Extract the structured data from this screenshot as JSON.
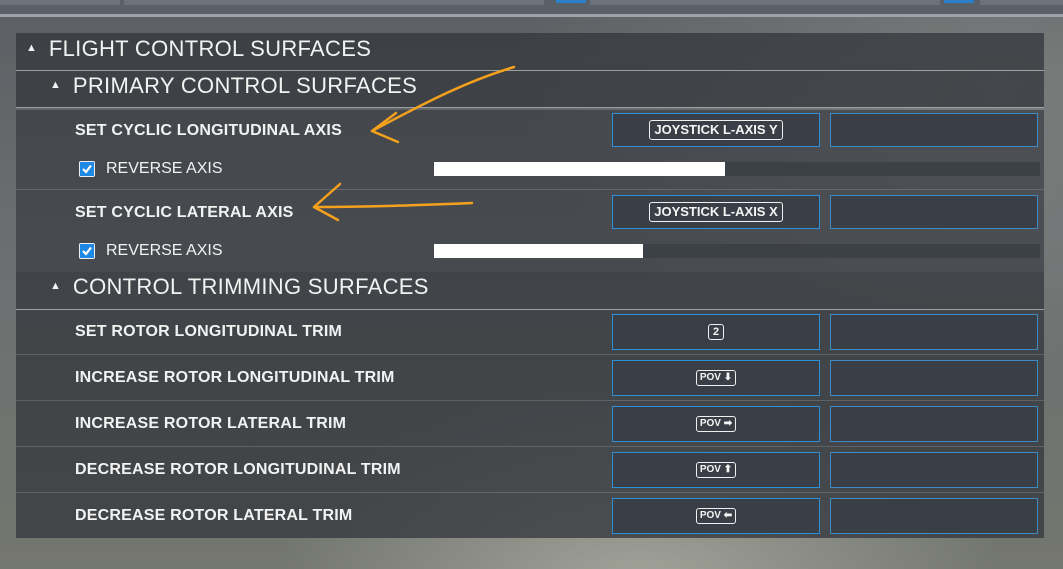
{
  "sections": {
    "flight_control": "FLIGHT CONTROL SURFACES",
    "primary": "PRIMARY CONTROL SURFACES",
    "trimming": "CONTROL TRIMMING SURFACES"
  },
  "primary_rows": [
    {
      "label": "SET CYCLIC LONGITUDINAL AXIS",
      "binding": "JOYSTICK L-AXIS Y",
      "reverse_label": "REVERSE AXIS",
      "reverse_checked": true,
      "axis_position": 0.48
    },
    {
      "label": "SET CYCLIC LATERAL AXIS",
      "binding": "JOYSTICK L-AXIS X",
      "reverse_label": "REVERSE AXIS",
      "reverse_checked": true,
      "axis_position": 0.345
    }
  ],
  "trim_rows": [
    {
      "label": "SET ROTOR LONGITUDINAL TRIM",
      "binding": "2"
    },
    {
      "label": "INCREASE ROTOR LONGITUDINAL TRIM",
      "binding": "POV ⬇"
    },
    {
      "label": "INCREASE ROTOR LATERAL TRIM",
      "binding": "POV ➡"
    },
    {
      "label": "DECREASE ROTOR LONGITUDINAL TRIM",
      "binding": "POV ⬆"
    },
    {
      "label": "DECREASE ROTOR LATERAL TRIM",
      "binding": "POV ⬅"
    }
  ],
  "colors": {
    "accent": "#2c8fd8",
    "annotation": "#f5a11d",
    "checkbox": "#1e88e5"
  }
}
